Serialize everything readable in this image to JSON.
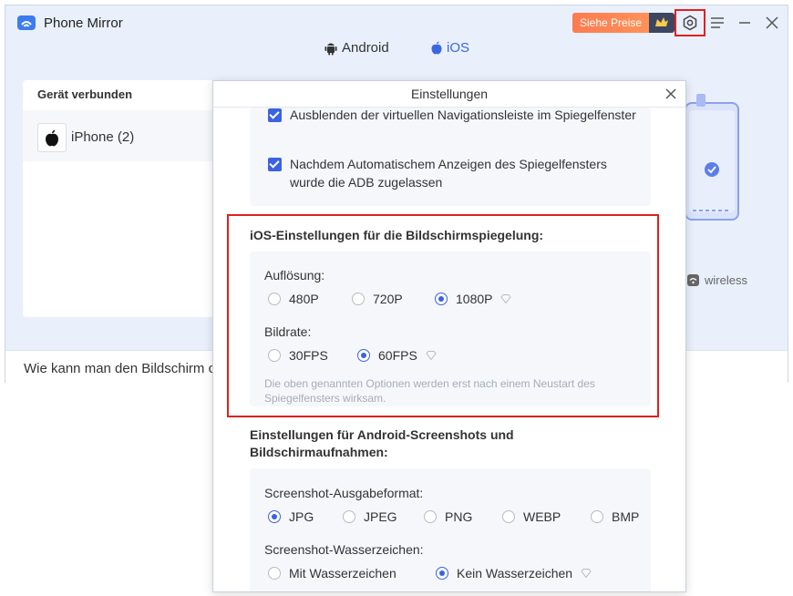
{
  "app": {
    "title": "Phone Mirror",
    "promo_label": "Siehe Preise"
  },
  "tabs": [
    {
      "label": "Android"
    },
    {
      "label": "iOS"
    }
  ],
  "device_panel": {
    "header": "Gerät verbunden",
    "device_name": "iPhone (2)"
  },
  "wireless_label": "wireless",
  "bottom_bar": {
    "text": "Wie kann man den Bildschirm c"
  },
  "dialog": {
    "title": "Einstellungen",
    "android_options": [
      {
        "label": "Ausblenden der virtuellen Navigationsleiste im Spiegelfenster",
        "checked": true
      },
      {
        "label": "Nachdem Automatischem Anzeigen des Spiegelfensters wurde die ADB zugelassen",
        "checked": true
      }
    ],
    "ios_section": {
      "title": "iOS-Einstellungen für die Bildschirmspiegelung:",
      "resolution_label": "Auflösung:",
      "resolution_options": [
        "480P",
        "720P",
        "1080P"
      ],
      "resolution_selected": "1080P",
      "framerate_label": "Bildrate:",
      "framerate_options": [
        "30FPS",
        "60FPS"
      ],
      "framerate_selected": "60FPS",
      "note": "Die oben genannten Optionen werden erst nach einem Neustart des Spiegelfensters wirksam."
    },
    "android_screenshot_section": {
      "title": "Einstellungen für Android-Screenshots und Bildschirmaufnahmen:",
      "format_label": "Screenshot-Ausgabeformat:",
      "format_options": [
        "JPG",
        "JPEG",
        "PNG",
        "WEBP",
        "BMP"
      ],
      "format_selected": "JPG",
      "watermark_label": "Screenshot-Wasserzeichen:",
      "watermark_options": [
        "Mit Wasserzeichen",
        "Kein Wasserzeichen"
      ],
      "watermark_selected": "Kein Wasserzeichen"
    }
  },
  "colors": {
    "accent": "#3b62e0",
    "highlight_border": "#e02020",
    "promo": "#ff7a4f"
  }
}
